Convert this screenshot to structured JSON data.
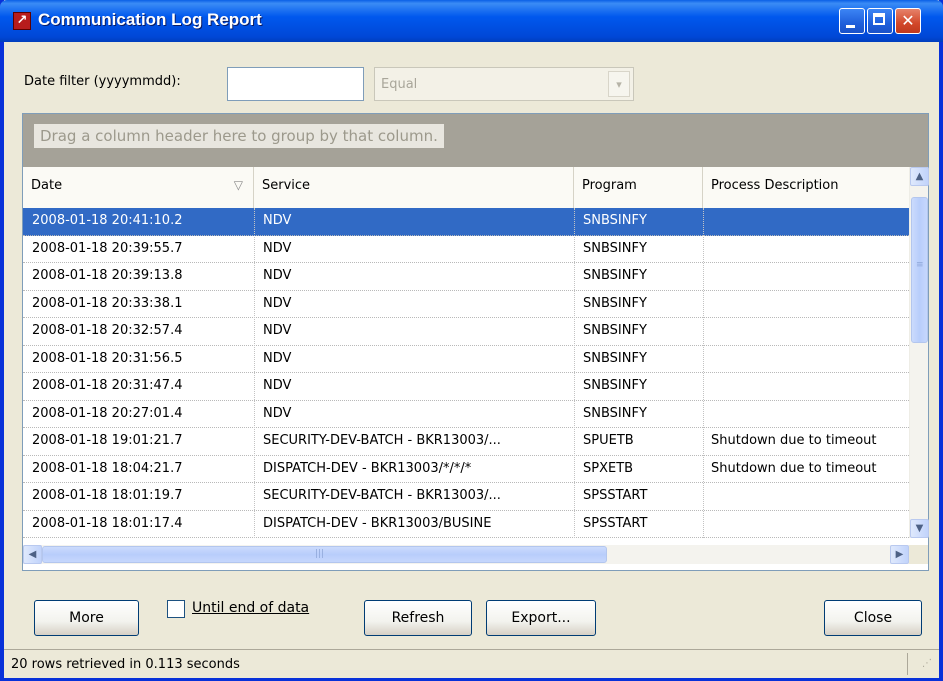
{
  "window": {
    "title": "Communication Log Report"
  },
  "filter": {
    "label": "Date filter (yyyymmdd):",
    "date_value": "",
    "operator": "Equal"
  },
  "grid": {
    "group_hint": "Drag a column header here to group by that column.",
    "columns": [
      "Date",
      "Service",
      "Program",
      "Process Description"
    ],
    "rows": [
      {
        "date": "2008-01-18 20:41:10.2",
        "service": "NDV",
        "program": "SNBSINFY",
        "desc": ""
      },
      {
        "date": "2008-01-18 20:39:55.7",
        "service": "NDV",
        "program": "SNBSINFY",
        "desc": ""
      },
      {
        "date": "2008-01-18 20:39:13.8",
        "service": "NDV",
        "program": "SNBSINFY",
        "desc": ""
      },
      {
        "date": "2008-01-18 20:33:38.1",
        "service": "NDV",
        "program": "SNBSINFY",
        "desc": ""
      },
      {
        "date": "2008-01-18 20:32:57.4",
        "service": "NDV",
        "program": "SNBSINFY",
        "desc": ""
      },
      {
        "date": "2008-01-18 20:31:56.5",
        "service": "NDV",
        "program": "SNBSINFY",
        "desc": ""
      },
      {
        "date": "2008-01-18 20:31:47.4",
        "service": "NDV",
        "program": "SNBSINFY",
        "desc": ""
      },
      {
        "date": "2008-01-18 20:27:01.4",
        "service": "NDV",
        "program": "SNBSINFY",
        "desc": ""
      },
      {
        "date": "2008-01-18 19:01:21.7",
        "service": "SECURITY-DEV-BATCH  -  BKR13003/...",
        "program": "SPUETB",
        "desc": "Shutdown due to timeout"
      },
      {
        "date": "2008-01-18 18:04:21.7",
        "service": "DISPATCH-DEV - BKR13003/*/*/*",
        "program": "SPXETB",
        "desc": "Shutdown due to timeout"
      },
      {
        "date": "2008-01-18 18:01:19.7",
        "service": "SECURITY-DEV-BATCH  -  BKR13003/...",
        "program": "SPSSTART",
        "desc": ""
      },
      {
        "date": "2008-01-18 18:01:17.4",
        "service": "DISPATCH-DEV  -  BKR13003/BUSINE",
        "program": "SPSSTART",
        "desc": ""
      }
    ],
    "selected_row": 0
  },
  "buttons": {
    "more": "More",
    "until_end": "Until end of data",
    "until_end_checked": false,
    "refresh": "Refresh",
    "export": "Export...",
    "close": "Close"
  },
  "status": {
    "text": "20 rows retrieved in 0.113 seconds"
  },
  "colors": {
    "selection": "#316ac5",
    "title_bar": "#0054e3",
    "window_bg": "#ece9d8"
  },
  "icons": {
    "app": "app-icon",
    "minimize": "minimize-icon",
    "maximize": "maximize-icon",
    "close": "close-icon",
    "sort": "sort-desc-icon"
  }
}
